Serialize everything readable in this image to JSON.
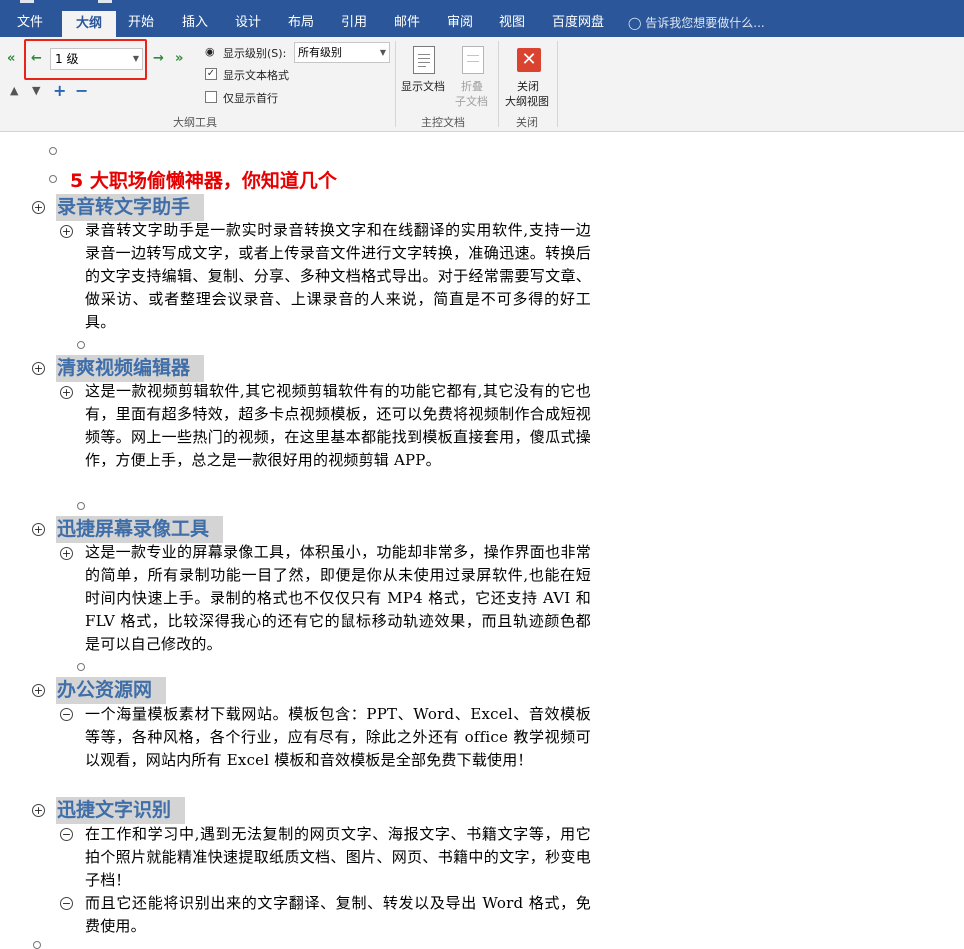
{
  "menu": {
    "tabs": [
      "文件",
      "大纲",
      "开始",
      "插入",
      "设计",
      "布局",
      "引用",
      "邮件",
      "审阅",
      "视图",
      "百度网盘"
    ],
    "tellme": "告诉我您想要做什么..."
  },
  "ribbon": {
    "level_value": "1 级",
    "show_level_label": "显示级别(S):",
    "show_level_value": "所有级别",
    "show_text_format": "显示文本格式",
    "show_first_line": "仅显示首行",
    "show_doc": "显示文档",
    "collapse_1": "折叠",
    "collapse_2": "子文档",
    "close_1": "关闭",
    "close_2": "大纲视图",
    "group_outline": "大纲工具",
    "group_master": "主控文档",
    "group_close": "关闭"
  },
  "doc": {
    "title": "5 大职场偷懒神器，你知道几个",
    "h1": "录音转文字助手",
    "p1": "录音转文字助手是一款实时录音转换文字和在线翻译的实用软件,支持一边录音一边转写成文字，或者上传录音文件进行文字转换，准确迅速。转换后的文字支持编辑、复制、分享、多种文档格式导出。对于经常需要写文章、做采访、或者整理会议录音、上课录音的人来说，简直是不可多得的好工具。",
    "h2": "清爽视频编辑器",
    "p2": "这是一款视频剪辑软件,其它视频剪辑软件有的功能它都有,其它没有的它也有，里面有超多特效，超多卡点视频模板，还可以免费将视频制作合成短视频等。网上一些热门的视频，在这里基本都能找到模板直接套用，傻瓜式操作，方便上手，总之是一款很好用的视频剪辑 APP。",
    "h3": "迅捷屏幕录像工具",
    "p3": "这是一款专业的屏幕录像工具，体积虽小，功能却非常多，操作界面也非常的简单，所有录制功能一目了然，即便是你从未使用过录屏软件,也能在短时间内快速上手。录制的格式也不仅仅只有 MP4 格式，它还支持 AVI 和 FLV 格式，比较深得我心的还有它的鼠标移动轨迹效果，而且轨迹颜色都是可以自己修改的。",
    "h4": "办公资源网",
    "p4": "一个海量模板素材下载网站。模板包含：PPT、Word、Excel、音效模板等等，各种风格，各个行业，应有尽有，除此之外还有 office 教学视频可以观看，网站内所有 Excel 模板和音效模板是全部免费下载使用！",
    "h5": "迅捷文字识别",
    "p5a": "在工作和学习中,遇到无法复制的网页文字、海报文字、书籍文字等，用它拍个照片就能精准快速提取纸质文档、图片、网页、书籍中的文字，秒变电子档！",
    "p5b": "而且它还能将识别出来的文字翻译、复制、转发以及导出 Word 格式，免费使用。"
  },
  "colors": {
    "ribbon_blue": "#2b579a",
    "heading_blue": "#3f6ea9",
    "title_red": "#e60000",
    "highlight_red": "#e8231a"
  }
}
